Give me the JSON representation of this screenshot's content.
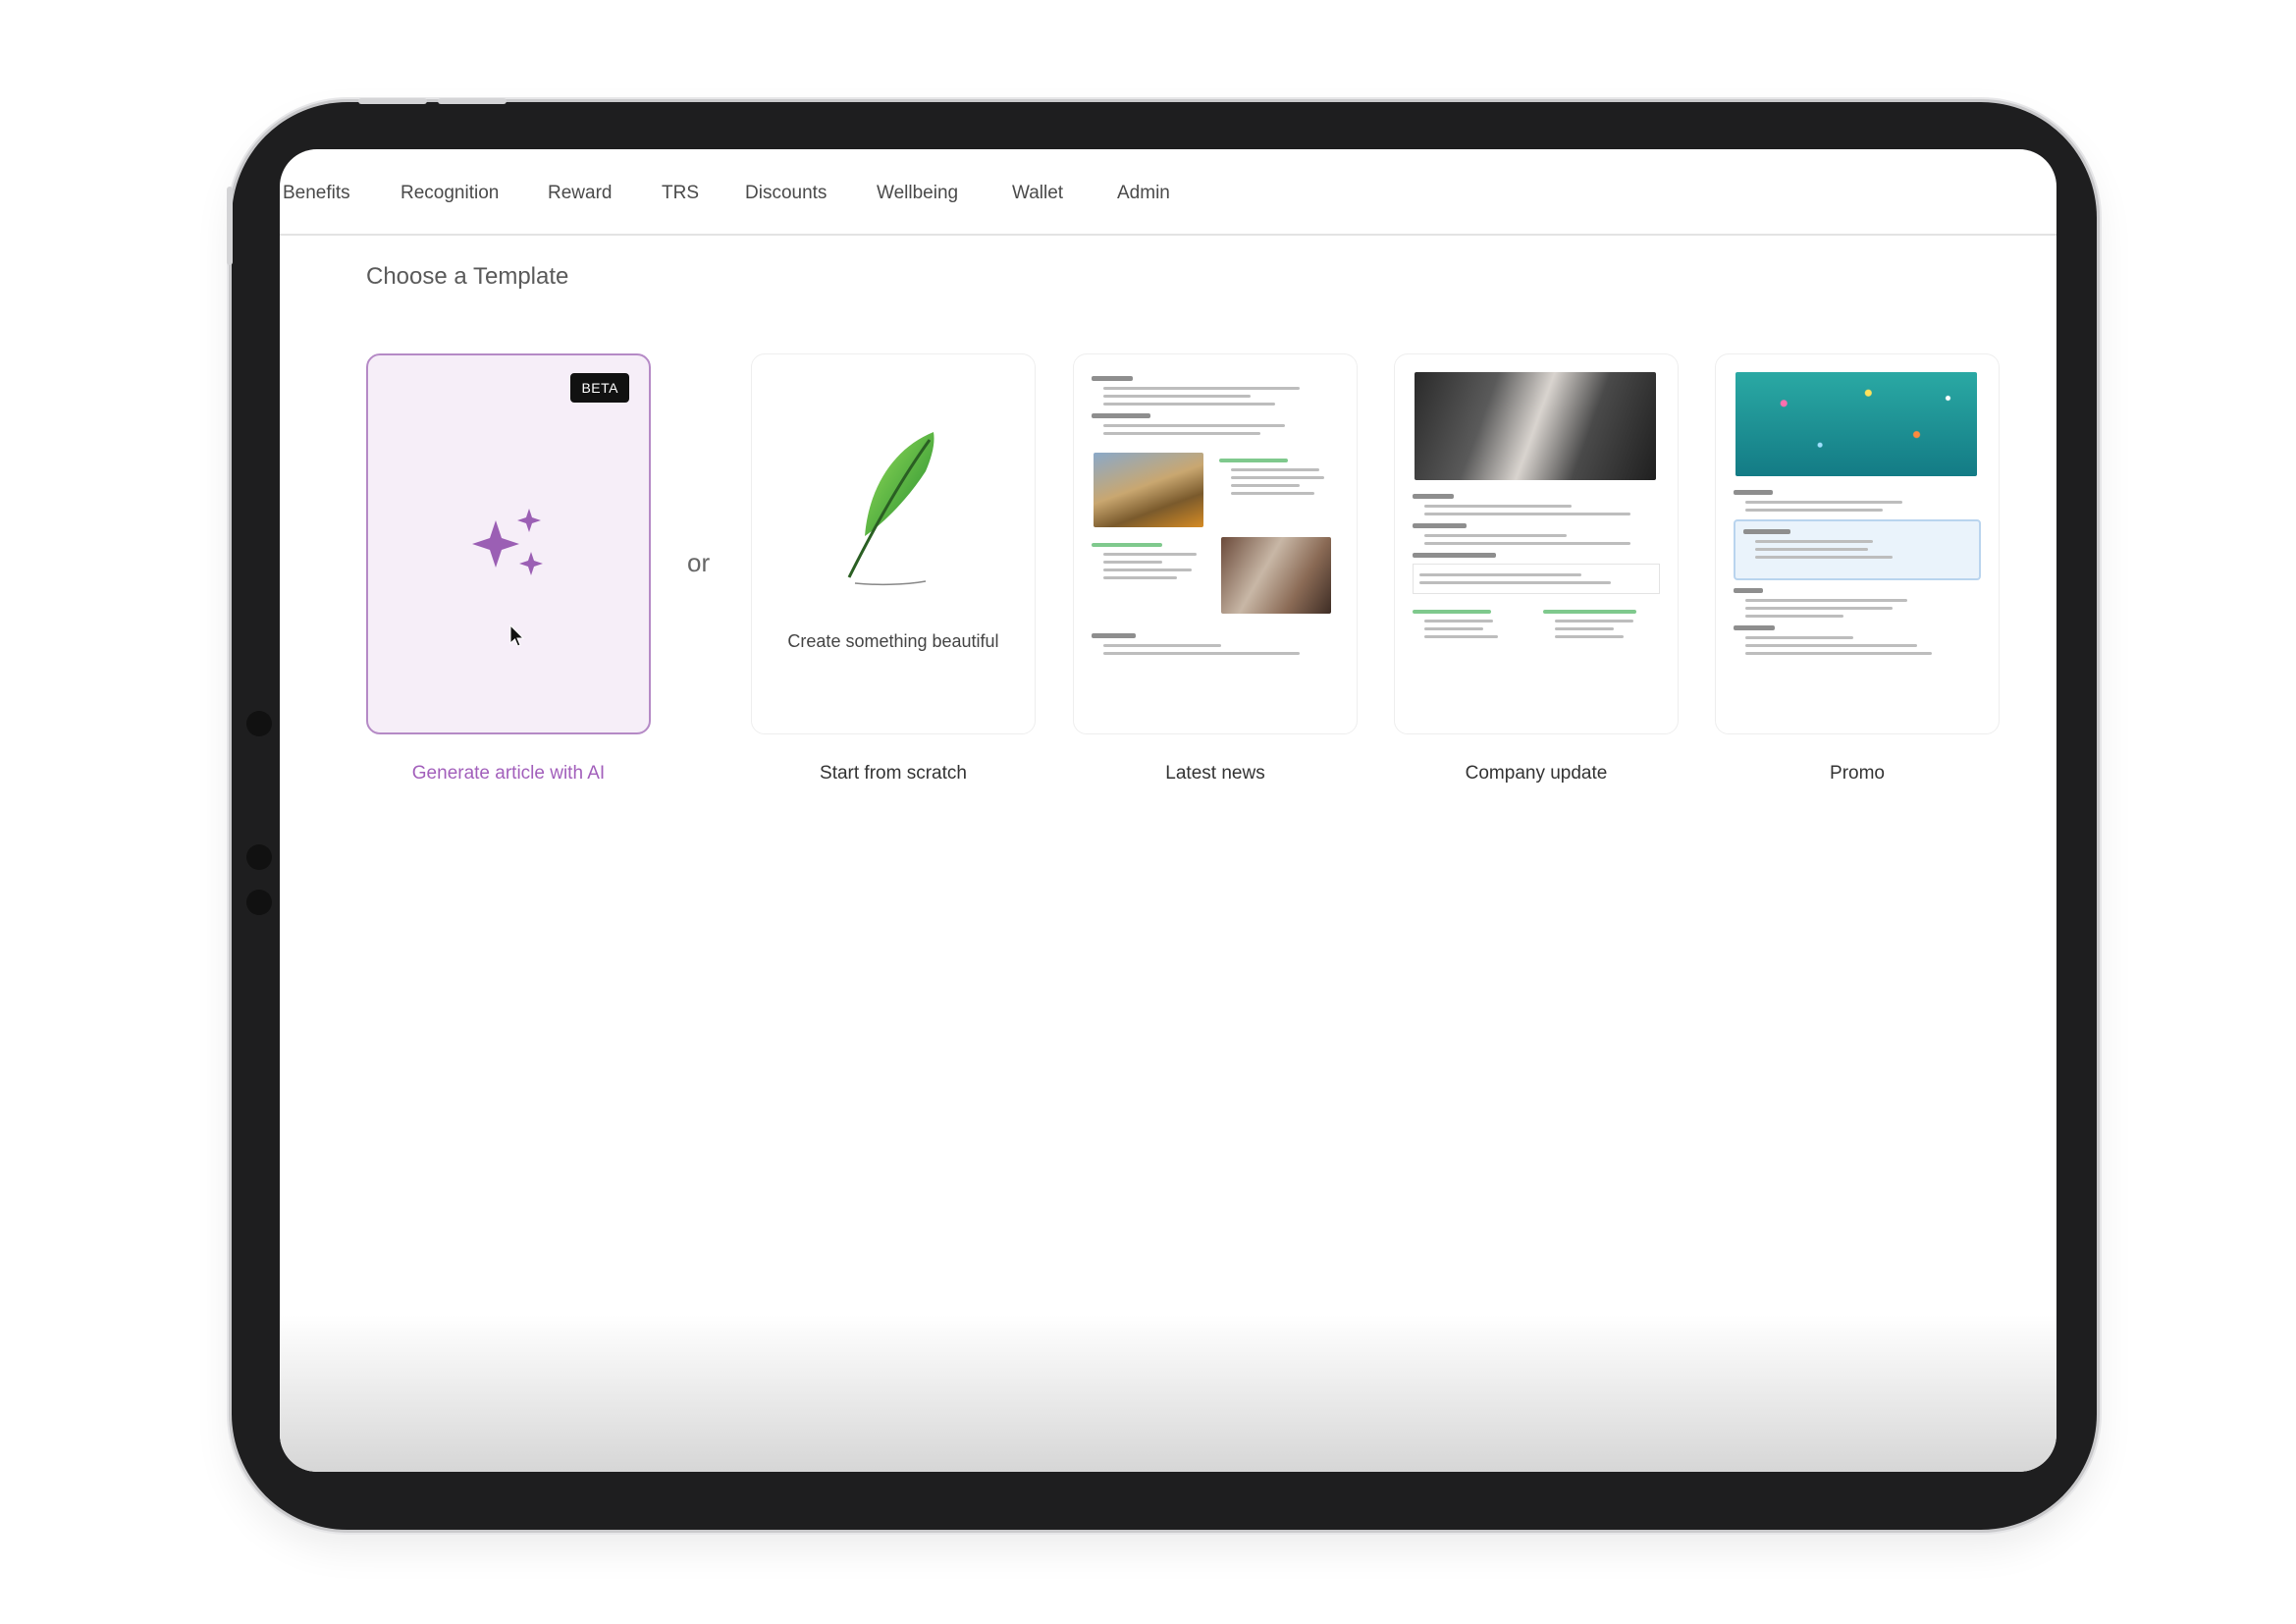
{
  "nav": {
    "items": [
      "Benefits",
      "Recognition",
      "Reward",
      "TRS",
      "Discounts",
      "Wellbeing",
      "Wallet",
      "Admin"
    ]
  },
  "section_title": "Choose a Template",
  "separator_text": "or",
  "templates": [
    {
      "label": "Generate article with AI",
      "badge": "BETA",
      "icon": "sparkles-icon",
      "accent": "#a25fbb"
    },
    {
      "label": "Start from scratch",
      "caption": "Create something beautiful",
      "icon": "feather-icon"
    },
    {
      "label": "Latest news"
    },
    {
      "label": "Company update"
    },
    {
      "label": "Promo"
    }
  ],
  "colors": {
    "ai_card_bg": "#f6eef8",
    "ai_card_border": "#b58ac6",
    "device_frame": "#1e1e1f"
  }
}
